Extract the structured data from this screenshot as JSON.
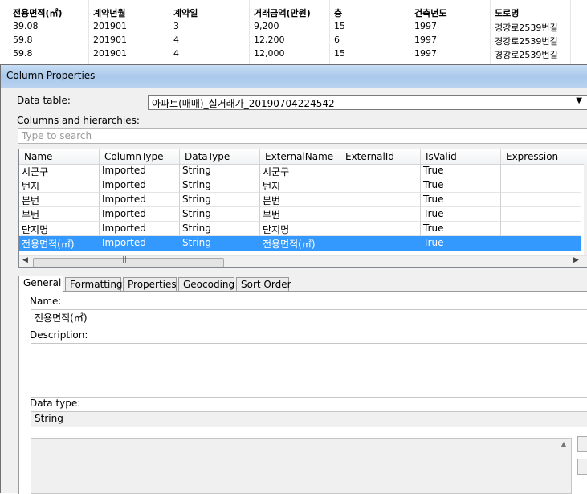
{
  "background_table": {
    "headers": [
      "전용면적(㎡)",
      "계약년월",
      "계약일",
      "거래금액(만원)",
      "층",
      "건축년도",
      "도로명"
    ],
    "rows": [
      [
        "39.08",
        "201901",
        "3",
        "9,200",
        "15",
        "1997",
        "경강로2539번길"
      ],
      [
        "59.8",
        "201901",
        "4",
        "12,200",
        "6",
        "1997",
        "경강로2539번길"
      ],
      [
        "59.8",
        "201901",
        "4",
        "12,000",
        "15",
        "1997",
        "경강로2539번길"
      ]
    ]
  },
  "dialog": {
    "title": "Column Properties",
    "data_table_label": "Data table:",
    "data_table_value": "아파트(매매)_실거래가_20190704224542",
    "columns_label": "Columns and hierarchies:",
    "search_placeholder": "Type to search",
    "grid": {
      "headers": [
        "Name",
        "ColumnType",
        "DataType",
        "ExternalName",
        "ExternalId",
        "IsValid",
        "Expression"
      ],
      "rows": [
        [
          "시군구",
          "Imported",
          "String",
          "시군구",
          "",
          "True",
          ""
        ],
        [
          "번지",
          "Imported",
          "String",
          "번지",
          "",
          "True",
          ""
        ],
        [
          "본번",
          "Imported",
          "String",
          "본번",
          "",
          "True",
          ""
        ],
        [
          "부번",
          "Imported",
          "String",
          "부번",
          "",
          "True",
          ""
        ],
        [
          "단지명",
          "Imported",
          "String",
          "단지명",
          "",
          "True",
          ""
        ],
        [
          "전용면적(㎡)",
          "Imported",
          "String",
          "전용면적(㎡)",
          "",
          "True",
          ""
        ]
      ],
      "selected_row": 5
    },
    "tabs": [
      "General",
      "Formatting",
      "Properties",
      "Geocoding",
      "Sort Order"
    ],
    "active_tab": "General",
    "general": {
      "name_label": "Name:",
      "name_value": "전용면적(㎡)",
      "description_label": "Description:",
      "description_value": "",
      "data_type_label": "Data type:",
      "data_type_value": "String"
    },
    "colors": {
      "selection": "#3399ff",
      "titlebar": "#b8d3f0"
    }
  }
}
